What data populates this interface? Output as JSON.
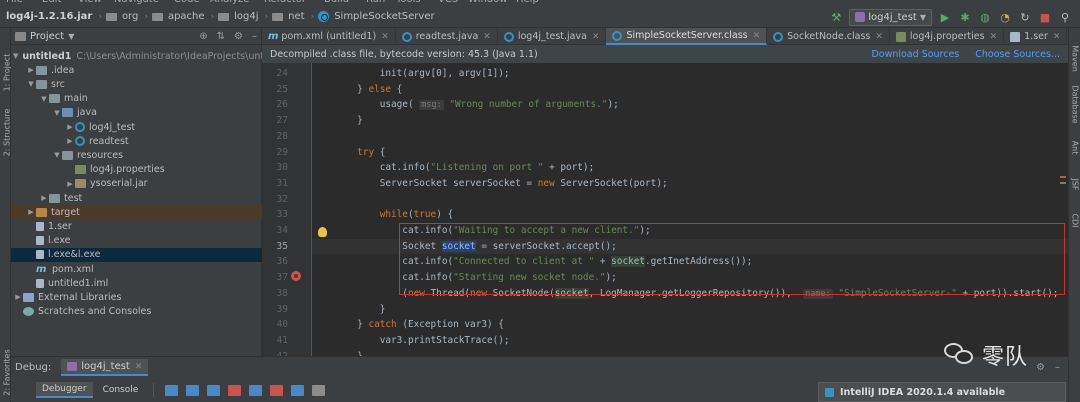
{
  "menu": [
    "File",
    "Edit",
    "View",
    "Navigate",
    "Code",
    "Analyze",
    "Refactor",
    "Build",
    "Run",
    "Tools",
    "VCS",
    "Window",
    "Help"
  ],
  "breadcrumb": [
    {
      "label": "log4j-1.2.16.jar",
      "icon": "jar-icon"
    },
    {
      "label": "org",
      "icon": "folder-icon"
    },
    {
      "label": "apache",
      "icon": "folder-icon"
    },
    {
      "label": "log4j",
      "icon": "folder-icon"
    },
    {
      "label": "net",
      "icon": "folder-icon"
    },
    {
      "label": "SimpleSocketServer",
      "icon": "class-icon"
    }
  ],
  "run_config": "log4j_test",
  "left_strip": {
    "project": "1: Project",
    "structure": "2: Structure",
    "favorites": "2: Favorites"
  },
  "right_strip": {
    "maven": "Maven",
    "database": "Database",
    "ant": "Ant",
    "jsf": "JSF",
    "cdi": "CDI"
  },
  "project_panel": {
    "title": "Project",
    "tree": [
      {
        "label": "untitled1",
        "path": "C:\\Users\\Administrator\\IdeaProjects\\untitled1",
        "icon": "folder",
        "depth": 0,
        "arrow": "down",
        "bold": true
      },
      {
        "label": ".idea",
        "icon": "folder",
        "depth": 1,
        "arrow": "right"
      },
      {
        "label": "src",
        "icon": "folder",
        "depth": 1,
        "arrow": "down"
      },
      {
        "label": "main",
        "icon": "folder",
        "depth": 2,
        "arrow": "down"
      },
      {
        "label": "java",
        "icon": "folder-src",
        "depth": 3,
        "arrow": "down"
      },
      {
        "label": "log4j_test",
        "icon": "class",
        "depth": 4,
        "arrow": "right"
      },
      {
        "label": "readtest",
        "icon": "class",
        "depth": 4,
        "arrow": "right"
      },
      {
        "label": "resources",
        "icon": "folder",
        "depth": 3,
        "arrow": "down"
      },
      {
        "label": "log4j.properties",
        "icon": "props",
        "depth": 4,
        "arrow": ""
      },
      {
        "label": "ysoserial.jar",
        "icon": "jar",
        "depth": 4,
        "arrow": "right"
      },
      {
        "label": "test",
        "icon": "folder",
        "depth": 2,
        "arrow": "right"
      },
      {
        "label": "target",
        "icon": "folder-orange",
        "depth": 1,
        "arrow": "right",
        "state": "orange"
      },
      {
        "label": "1.ser",
        "icon": "file",
        "depth": 1,
        "arrow": ""
      },
      {
        "label": "l.exe",
        "icon": "file",
        "depth": 1,
        "arrow": ""
      },
      {
        "label": "l.exe&l.exe",
        "icon": "file",
        "depth": 1,
        "arrow": "",
        "state": "sel"
      },
      {
        "label": "pom.xml",
        "icon": "m",
        "depth": 1,
        "arrow": ""
      },
      {
        "label": "untitled1.iml",
        "icon": "file",
        "depth": 1,
        "arrow": ""
      },
      {
        "label": "External Libraries",
        "icon": "lib",
        "depth": 0,
        "arrow": "right"
      },
      {
        "label": "Scratches and Consoles",
        "icon": "scr",
        "depth": 0,
        "arrow": ""
      }
    ]
  },
  "tabs": [
    {
      "label": "pom.xml (untitled1)",
      "icon": "m",
      "active": false
    },
    {
      "label": "readtest.java",
      "icon": "class",
      "active": false
    },
    {
      "label": "log4j_test.java",
      "icon": "class",
      "active": false
    },
    {
      "label": "SimpleSocketServer.class",
      "icon": "class",
      "active": true
    },
    {
      "label": "SocketNode.class",
      "icon": "class",
      "active": false
    },
    {
      "label": "log4j.properties",
      "icon": "props",
      "active": false
    },
    {
      "label": "1.ser",
      "icon": "file",
      "active": false
    }
  ],
  "banner": {
    "text": "Decompiled .class file, bytecode version: 45.3 (Java 1.1)",
    "download": "Download Sources",
    "choose": "Choose Sources..."
  },
  "editor": {
    "current_line": 35,
    "lines": [
      {
        "n": 24,
        "parts": [
          [
            "p",
            "            init(argv[0], argv[1]);"
          ]
        ]
      },
      {
        "n": 25,
        "parts": [
          [
            "p",
            "        } "
          ],
          [
            "k",
            "else"
          ],
          [
            "p",
            " {"
          ]
        ]
      },
      {
        "n": 26,
        "parts": [
          [
            "p",
            "            usage( "
          ],
          [
            "h",
            "msg:"
          ],
          [
            "p",
            " "
          ],
          [
            "s",
            "\"Wrong number of arguments.\""
          ],
          [
            "p",
            ");"
          ]
        ]
      },
      {
        "n": 27,
        "parts": [
          [
            "p",
            "        }"
          ]
        ]
      },
      {
        "n": 28,
        "parts": [
          [
            "p",
            ""
          ]
        ]
      },
      {
        "n": 29,
        "parts": [
          [
            "p",
            "        "
          ],
          [
            "k",
            "try"
          ],
          [
            "p",
            " {"
          ]
        ]
      },
      {
        "n": 30,
        "parts": [
          [
            "p",
            "            cat.info("
          ],
          [
            "s",
            "\"Listening on port \""
          ],
          [
            "p",
            " + port);"
          ]
        ]
      },
      {
        "n": 31,
        "parts": [
          [
            "p",
            "            ServerSocket serverSocket = "
          ],
          [
            "k",
            "new"
          ],
          [
            "p",
            " ServerSocket(port);"
          ]
        ]
      },
      {
        "n": 32,
        "parts": [
          [
            "p",
            ""
          ]
        ]
      },
      {
        "n": 33,
        "parts": [
          [
            "p",
            "            "
          ],
          [
            "k",
            "while"
          ],
          [
            "p",
            "("
          ],
          [
            "k",
            "true"
          ],
          [
            "p",
            ") {"
          ]
        ]
      },
      {
        "n": 34,
        "parts": [
          [
            "p",
            "                cat.info("
          ],
          [
            "s",
            "\"Waiting to accept a new client.\""
          ],
          [
            "p",
            ");"
          ]
        ]
      },
      {
        "n": 35,
        "parts": [
          [
            "p",
            "                Socket "
          ],
          [
            "hl",
            "socket"
          ],
          [
            "p",
            " = serverSocket.accept();"
          ]
        ]
      },
      {
        "n": 36,
        "parts": [
          [
            "p",
            "                cat.info("
          ],
          [
            "s",
            "\"Connected to client at \""
          ],
          [
            "p",
            " + "
          ],
          [
            "r",
            "socket"
          ],
          [
            "p",
            ".getInetAddress());"
          ]
        ]
      },
      {
        "n": 37,
        "parts": [
          [
            "p",
            "                cat.info("
          ],
          [
            "s",
            "\"Starting new socket node.\""
          ],
          [
            "p",
            ");"
          ]
        ]
      },
      {
        "n": 38,
        "parts": [
          [
            "p",
            "                ("
          ],
          [
            "k",
            "new"
          ],
          [
            "p",
            " Thread("
          ],
          [
            "k",
            "new"
          ],
          [
            "p",
            " SocketNode("
          ],
          [
            "r",
            "socket"
          ],
          [
            "p",
            ", LogManager.getLoggerRepository()),  "
          ],
          [
            "h",
            "name:"
          ],
          [
            "p",
            " "
          ],
          [
            "s",
            "\"SimpleSocketServer-\""
          ],
          [
            "p",
            " + port)).start();"
          ]
        ]
      },
      {
        "n": 39,
        "parts": [
          [
            "p",
            "            }"
          ]
        ]
      },
      {
        "n": 40,
        "parts": [
          [
            "p",
            "        } "
          ],
          [
            "k",
            "catch"
          ],
          [
            "p",
            " (Exception var3) {"
          ]
        ]
      },
      {
        "n": 41,
        "parts": [
          [
            "p",
            "            var3.printStackTrace();"
          ]
        ]
      },
      {
        "n": 42,
        "parts": [
          [
            "p",
            "        }"
          ]
        ]
      },
      {
        "n": 43,
        "parts": [
          [
            "p",
            "    }"
          ]
        ]
      }
    ]
  },
  "debug": {
    "label": "Debug:",
    "session": "log4j_test",
    "tabs": [
      "Debugger",
      "Console"
    ]
  },
  "notification": {
    "text": "IntelliJ IDEA 2020.1.4 available"
  },
  "watermark": {
    "text": "零队"
  },
  "colors": {
    "keyword": "#cc7832",
    "string": "#6a8759",
    "accent": "#4a88c7",
    "breakpoint": "#c75450",
    "highlight_box": "#c83232"
  }
}
